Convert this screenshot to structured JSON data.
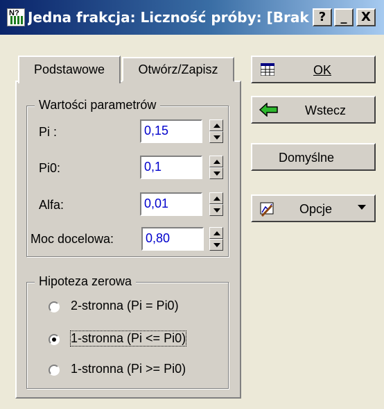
{
  "window": {
    "title": "Jedna frakcja: Liczność próby: [Brak",
    "app_icon_letter": "N?"
  },
  "titlebar_buttons": {
    "help": "?",
    "minimize": "_",
    "close": "X"
  },
  "tabs": [
    {
      "label": "Podstawowe",
      "active": true
    },
    {
      "label": "Otwórz/Zapisz",
      "active": false
    }
  ],
  "params": {
    "legend": "Wartości parametrów",
    "rows": [
      {
        "label": "Pi :",
        "value": "0,15"
      },
      {
        "label": "Pi0:",
        "value": "0,1"
      },
      {
        "label": "Alfa:",
        "value": "0,01"
      },
      {
        "label": "Moc docelowa:",
        "value": "0,80"
      }
    ]
  },
  "hypothesis": {
    "legend": "Hipoteza zerowa",
    "options": [
      {
        "label": "2-stronna (Pi = Pi0)",
        "selected": false
      },
      {
        "label": "1-stronna (Pi <= Pi0)",
        "selected": true
      },
      {
        "label": "1-stronna (Pi >= Pi0)",
        "selected": false
      }
    ]
  },
  "buttons": {
    "ok": "OK",
    "back": "Wstecz",
    "defaults": "Domyślne",
    "options": "Opcje"
  },
  "colors": {
    "value_text": "#0000cc",
    "title_grad_start": "#0a246a",
    "title_grad_end": "#a6caf0",
    "back_arrow": "#2eb82e"
  }
}
